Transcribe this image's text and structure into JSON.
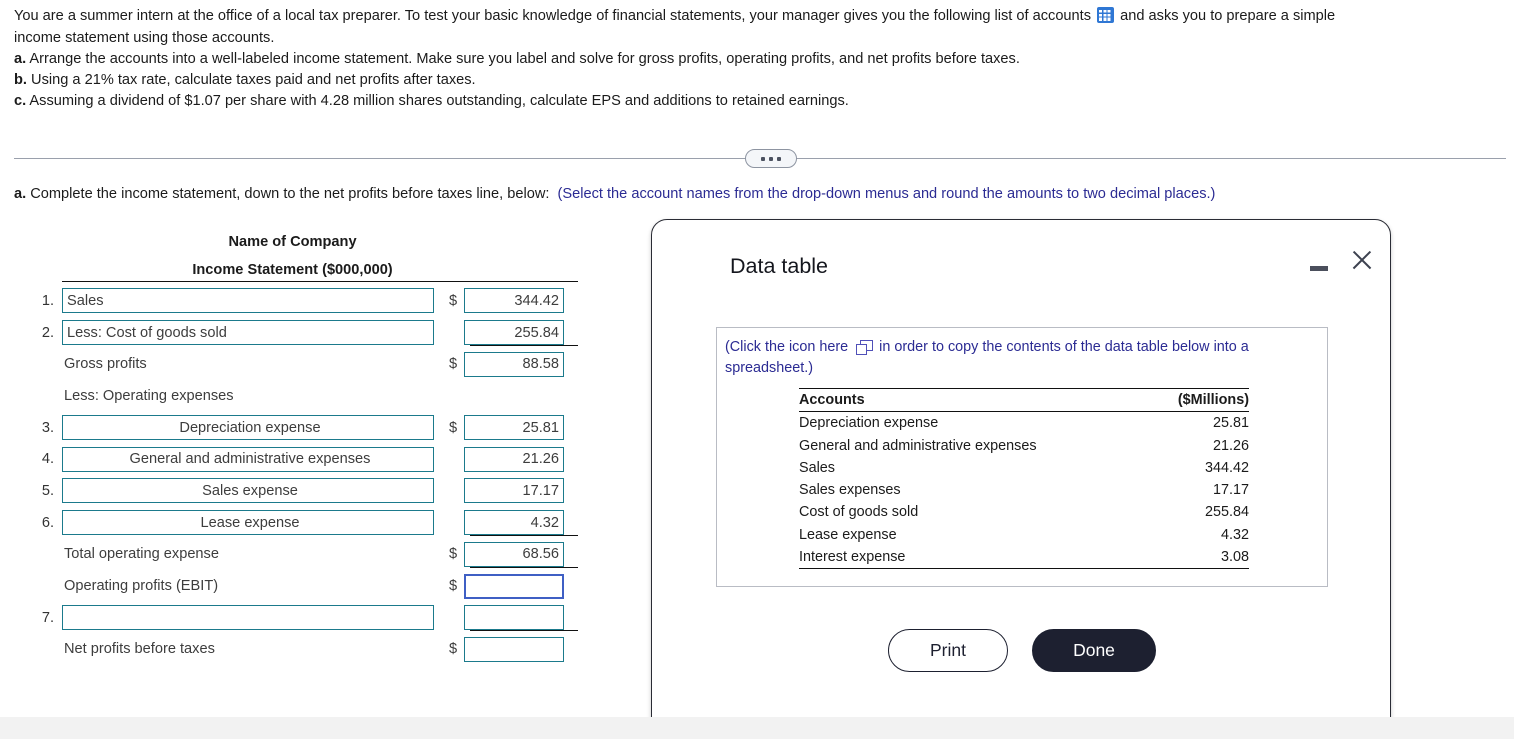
{
  "problem": {
    "line1_a": "You are a summer intern at the office of a local tax preparer. To test your basic knowledge of financial statements, your manager gives you the following list of accounts",
    "line1_b": "and asks you to prepare a simple",
    "line2": "income statement using those accounts.",
    "a_letter": "a.",
    "a_text": "Arrange the accounts into a well-labeled income statement. Make sure you label and solve for gross profits, operating profits, and net profits before taxes.",
    "b_letter": "b.",
    "b_text": "Using a 21% tax rate, calculate taxes paid and net profits after taxes.",
    "c_letter": "c.",
    "c_text": "Assuming a dividend of $1.07 per share with 4.28 million shares outstanding, calculate EPS and additions to retained earnings.",
    "grid_icon": "table-grid-icon"
  },
  "part_a": {
    "letter": "a.",
    "text": "Complete the income statement, down to the net profits before taxes line, below:",
    "hint": "(Select the account names from the drop-down menus and round the amounts to two decimal places.)"
  },
  "statement": {
    "title1": "Name of Company",
    "title2": "Income Statement ($000,000)",
    "rows": [
      {
        "num": "1.",
        "kind": "dropdown",
        "label": "Sales",
        "indent": false,
        "dollar": "$",
        "amount": "344.42",
        "focused": false
      },
      {
        "num": "2.",
        "kind": "dropdown",
        "label": "Less: Cost of goods sold",
        "indent": false,
        "dollar": "",
        "amount": "255.84",
        "focused": false
      },
      {
        "num": "",
        "kind": "static",
        "label": "Gross profits",
        "indent": false,
        "dollar": "$",
        "amount": "88.58",
        "focused": false
      },
      {
        "num": "",
        "kind": "text",
        "label": "Less: Operating expenses",
        "indent": false,
        "dollar": "",
        "amount": null,
        "focused": false
      },
      {
        "num": "3.",
        "kind": "dropdown",
        "label": "Depreciation expense",
        "indent": true,
        "dollar": "$",
        "amount": "25.81",
        "focused": false
      },
      {
        "num": "4.",
        "kind": "dropdown",
        "label": "General and administrative expenses",
        "indent": true,
        "dollar": "",
        "amount": "21.26",
        "focused": false
      },
      {
        "num": "5.",
        "kind": "dropdown",
        "label": "Sales expense",
        "indent": true,
        "dollar": "",
        "amount": "17.17",
        "focused": false
      },
      {
        "num": "6.",
        "kind": "dropdown",
        "label": "Lease expense",
        "indent": true,
        "dollar": "",
        "amount": "4.32",
        "focused": false
      },
      {
        "num": "",
        "kind": "static",
        "label": "Total operating expense",
        "indent": false,
        "dollar": "$",
        "amount": "68.56",
        "focused": false
      },
      {
        "num": "",
        "kind": "static",
        "label": "Operating profits (EBIT)",
        "indent": false,
        "dollar": "$",
        "amount": "",
        "focused": true
      },
      {
        "num": "7.",
        "kind": "dropdown",
        "label": "",
        "indent": false,
        "dollar": "",
        "amount": "",
        "focused": false
      },
      {
        "num": "",
        "kind": "static",
        "label": "Net profits before taxes",
        "indent": false,
        "dollar": "$",
        "amount": "",
        "focused": false
      }
    ]
  },
  "modal": {
    "title": "Data table",
    "minimize_icon": "minimize-icon",
    "close_icon": "close-icon",
    "note_part1": "(Click the icon here",
    "copy_icon": "copy-icon",
    "note_part2": "in order to copy the contents of the data table below into a spreadsheet.)",
    "table": {
      "headers": [
        "Accounts",
        "($Millions)"
      ],
      "rows": [
        {
          "account": "Depreciation expense",
          "value": "25.81"
        },
        {
          "account": "General and administrative expenses",
          "value": "21.26"
        },
        {
          "account": "Sales",
          "value": "344.42"
        },
        {
          "account": "Sales expenses",
          "value": "17.17"
        },
        {
          "account": "Cost of goods sold",
          "value": "255.84"
        },
        {
          "account": "Lease expense",
          "value": "4.32"
        },
        {
          "account": "Interest expense",
          "value": "3.08"
        }
      ]
    },
    "print_label": "Print",
    "done_label": "Done"
  },
  "colors": {
    "input_border": "#1b7a8c",
    "focus_border": "#3f5fc4",
    "hint_text": "#2b2b93",
    "accent_dark": "#1d2030",
    "grid_icon_blue": "#2f77d4"
  }
}
